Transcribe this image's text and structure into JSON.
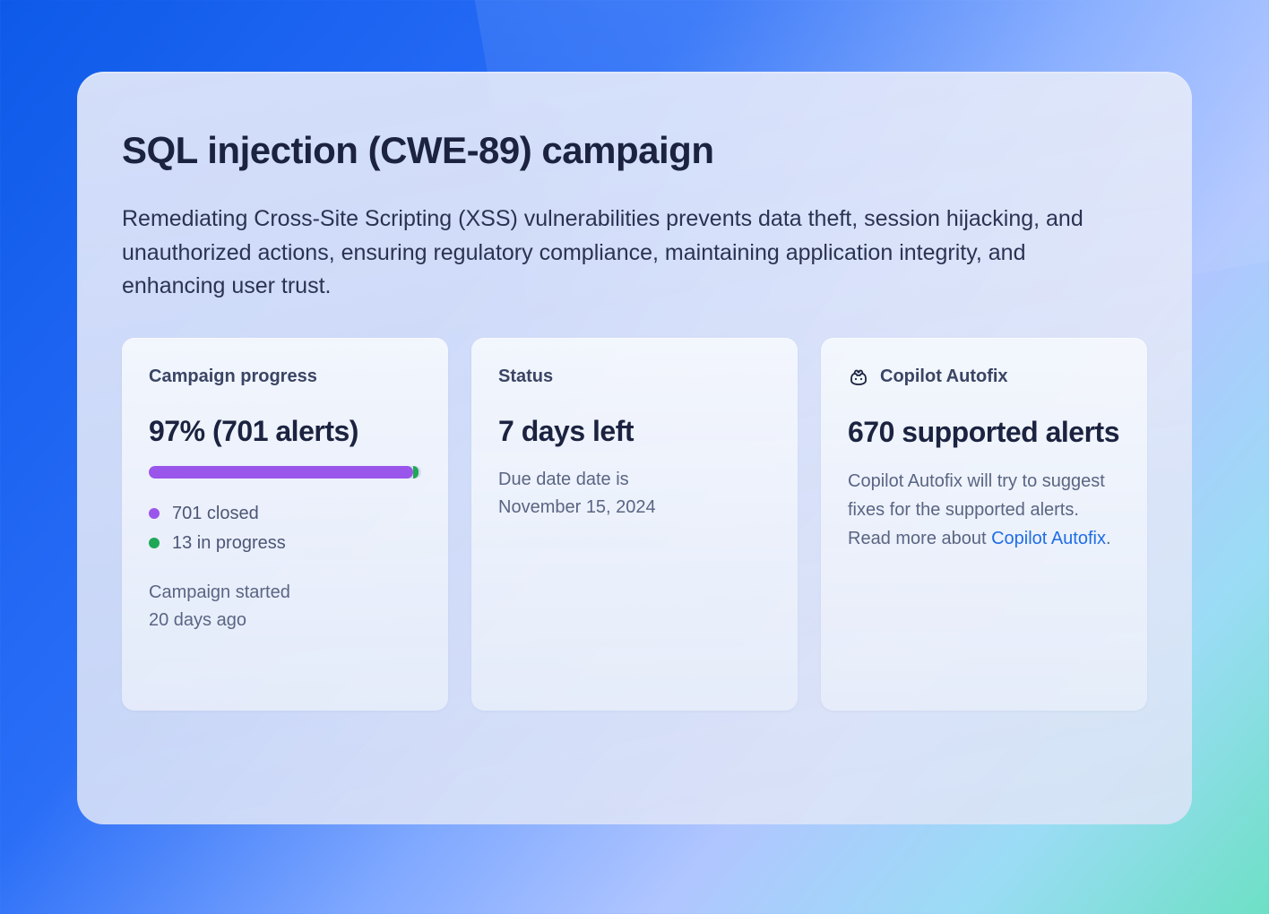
{
  "title": "SQL injection (CWE-89) campaign",
  "description": "Remediating Cross-Site Scripting (XSS) vulnerabilities prevents data theft, session hijacking, and unauthorized actions, ensuring regulatory compliance, maintaining application integrity, and enhancing user trust.",
  "progress": {
    "label": "Campaign progress",
    "headline": "97% (701 alerts)",
    "percent_closed": 97,
    "percent_inprogress": 2,
    "legend_closed": "701 closed",
    "legend_inprogress": "13 in progress",
    "started_line1": "Campaign started",
    "started_line2": "20 days ago"
  },
  "status": {
    "label": "Status",
    "headline": "7 days left",
    "due_line1": "Due date date is",
    "due_line2": "November 15, 2024"
  },
  "autofix": {
    "label": "Copilot Autofix",
    "headline": "670 supported alerts",
    "body_prefix": "Copilot Autofix will try to suggest fixes for the supported alerts. Read more about ",
    "link_text": "Copilot Autofix",
    "body_suffix": "."
  },
  "chart_data": {
    "type": "bar",
    "title": "Campaign progress",
    "categories": [
      "closed",
      "in progress"
    ],
    "series": [
      {
        "name": "alerts",
        "values": [
          701,
          13
        ]
      }
    ],
    "percent_complete": 97
  }
}
